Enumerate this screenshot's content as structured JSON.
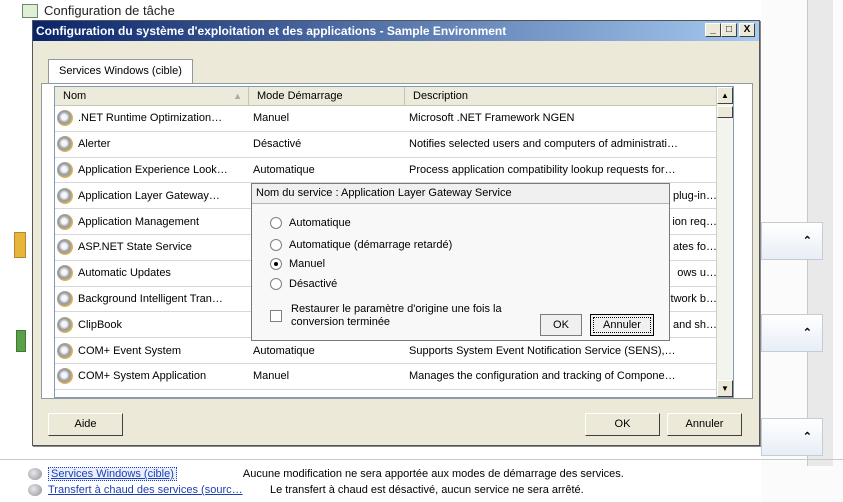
{
  "background": {
    "task_title": "Configuration de tâche",
    "bottom_list": [
      {
        "link": "Services Windows (cible)",
        "desc": "Aucune modification ne sera apportée aux modes de démarrage des services."
      },
      {
        "link": "Transfert à chaud des services (sourc…",
        "desc": "Le transfert à chaud est désactivé, aucun service ne sera arrêté."
      }
    ],
    "chevron": "⌃"
  },
  "dialog": {
    "title": "Configuration du système d'exploitation et des applications - Sample Environment",
    "window_buttons": {
      "minimize": "_",
      "maximize": "□",
      "close": "X"
    },
    "tab_label": "Services Windows (cible)",
    "columns": [
      "Nom",
      "Mode Démarrage",
      "Description"
    ],
    "rows": [
      {
        "name": ".NET Runtime Optimization…",
        "mode": "Manuel",
        "desc": "Microsoft .NET Framework NGEN"
      },
      {
        "name": "Alerter",
        "mode": "Désactivé",
        "desc": "Notifies selected users and computers of administrati…"
      },
      {
        "name": "Application Experience Look…",
        "mode": "Automatique",
        "desc": "Process application compatibility lookup requests for…"
      },
      {
        "name": "Application Layer Gateway…",
        "mode": "",
        "desc": "plug-in…"
      },
      {
        "name": "Application Management",
        "mode": "",
        "desc": "ion req…"
      },
      {
        "name": "ASP.NET State Service",
        "mode": "",
        "desc": "ates fo…"
      },
      {
        "name": "Automatic Updates",
        "mode": "",
        "desc": "ows u…"
      },
      {
        "name": "Background Intelligent Tran…",
        "mode": "",
        "desc": "twork b…"
      },
      {
        "name": "ClipBook",
        "mode": "",
        "desc": "and sh…"
      },
      {
        "name": "COM+ Event System",
        "mode": "Automatique",
        "desc": "Supports System Event Notification Service (SENS),…"
      },
      {
        "name": "COM+ System Application",
        "mode": "Manuel",
        "desc": "Manages the configuration and tracking of Compone…"
      }
    ],
    "help_label": "Aide",
    "ok_label": "OK",
    "cancel_label": "Annuler"
  },
  "popup": {
    "title": "Nom du service : Application Layer Gateway Service",
    "options": [
      "Automatique",
      "Automatique (démarrage retardé)",
      "Manuel",
      "Désactivé"
    ],
    "selected_index": 2,
    "restore_label": "Restaurer le paramètre d'origine une fois la conversion terminée",
    "ok_label": "OK",
    "cancel_label": "Annuler"
  }
}
